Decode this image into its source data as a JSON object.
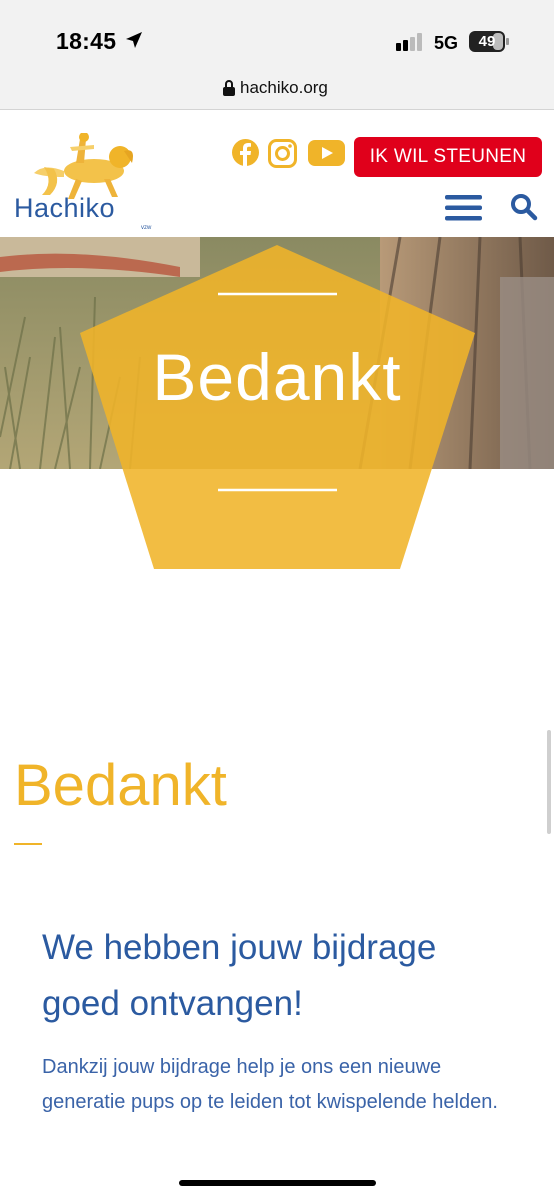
{
  "status_bar": {
    "time": "18:45",
    "network": "5G",
    "battery": "49"
  },
  "address_bar": {
    "url": "hachiko.org"
  },
  "header": {
    "logo_text": "Hachiko",
    "logo_suffix": "vzw",
    "donate_label": "IK WIL STEUNEN",
    "social": [
      "facebook-icon",
      "instagram-icon",
      "youtube-icon"
    ]
  },
  "hero": {
    "title": "Bedankt",
    "accent_color": "#f0b429"
  },
  "content": {
    "heading": "Bedankt",
    "subheading": "We hebben jouw bijdrage goed ontvangen!",
    "body": "Dankzij jouw bijdrage help je ons een nieuwe generatie pups op te leiden tot kwispelende helden."
  },
  "colors": {
    "brand_blue": "#2b5aa0",
    "brand_yellow": "#f0b429",
    "donate_red": "#e0001b"
  }
}
